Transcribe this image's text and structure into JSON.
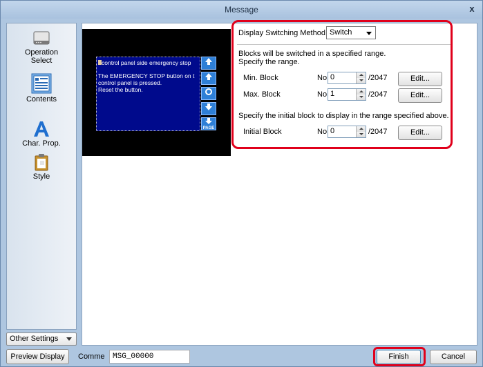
{
  "window": {
    "title": "Message",
    "close_glyph": "x"
  },
  "sidebar": {
    "items": [
      {
        "label_line1": "Operation",
        "label_line2": "Select",
        "icon": "operation-select-icon"
      },
      {
        "label": "Contents",
        "icon": "contents-icon"
      },
      {
        "label": "Char. Prop.",
        "icon": "char-prop-icon"
      },
      {
        "label": "Style",
        "icon": "style-icon"
      }
    ],
    "other_settings": "Other Settings"
  },
  "preview": {
    "lines": [
      "control panel side emergency stop",
      "The EMERGENCY STOP button on t",
      "control panel is pressed.",
      "Reset the button."
    ],
    "scroll_buttons": [
      "up-icon",
      "up-icon",
      "circle-icon",
      "down-icon",
      "page-down-icon"
    ],
    "page_down_label": "PAGE"
  },
  "settings": {
    "switching_method_label": "Display Switching Method",
    "switching_method_value": "Switch",
    "range_desc_line1": "Blocks will be switched in a specified range.",
    "range_desc_line2": "Specify the range.",
    "min_block_label": "Min. Block",
    "min_block_no": "No",
    "min_block_value": "0",
    "min_block_max": "/2047",
    "max_block_label": "Max. Block",
    "max_block_no": "No",
    "max_block_value": "1",
    "max_block_max": "/2047",
    "initial_desc": "Specify the initial block to display in the range specified above.",
    "initial_block_label": "Initial Block",
    "initial_block_no": "No",
    "initial_block_value": "0",
    "initial_block_max": "/2047",
    "edit_label": "Edit..."
  },
  "bottom": {
    "preview_display": "Preview Display",
    "comment_label": "Comme",
    "comment_value": "MSG_00000",
    "finish": "Finish",
    "cancel": "Cancel"
  },
  "colors": {
    "highlight": "#e0001b",
    "message_bg": "#000a8c",
    "scroll_button": "#2e7fd6"
  }
}
